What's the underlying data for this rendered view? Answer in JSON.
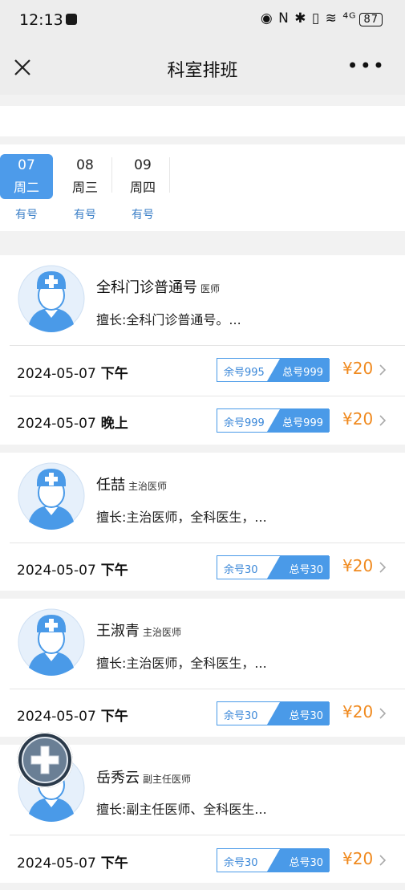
{
  "status_bar": {
    "time": "12:13",
    "icons_text": "◉ N ✱ ▯ ≋ ⁴ᴳ",
    "battery": "87"
  },
  "nav": {
    "title": "科室排班",
    "close_icon": "close-icon",
    "more_label": "•••"
  },
  "dates": [
    {
      "day": "07",
      "week": "周二",
      "avail": "有号",
      "active": true
    },
    {
      "day": "08",
      "week": "周三",
      "avail": "有号",
      "active": false
    },
    {
      "day": "09",
      "week": "周四",
      "avail": "有号",
      "active": false
    }
  ],
  "doctors": [
    {
      "name": "全科门诊普通号",
      "title": "医师",
      "skill": "擅长:全科门诊普通号。...",
      "slots": [
        {
          "date": "2024-05-07",
          "period": "下午",
          "remain": "余号995",
          "total": "总号999",
          "price": "¥20"
        },
        {
          "date": "2024-05-07",
          "period": "晚上",
          "remain": "余号999",
          "total": "总号999",
          "price": "¥20"
        }
      ]
    },
    {
      "name": "任喆",
      "title": "主治医师",
      "skill": "擅长:主治医师，全科医生，...",
      "slots": [
        {
          "date": "2024-05-07",
          "period": "下午",
          "remain": "余号30",
          "total": "总号30",
          "price": "¥20"
        }
      ]
    },
    {
      "name": "王淑青",
      "title": "主治医师",
      "skill": "擅长:主治医师，全科医生，...",
      "slots": [
        {
          "date": "2024-05-07",
          "period": "下午",
          "remain": "余号30",
          "total": "总号30",
          "price": "¥20"
        }
      ]
    },
    {
      "name": "岳秀云",
      "title": "副主任医师",
      "skill": "擅长:副主任医师、全科医生...",
      "slots": [
        {
          "date": "2024-05-07",
          "period": "下午",
          "remain": "余号30",
          "total": "总号30",
          "price": "¥20"
        }
      ]
    }
  ],
  "colors": {
    "accent": "#4a9ae8",
    "price": "#f08a1f"
  }
}
